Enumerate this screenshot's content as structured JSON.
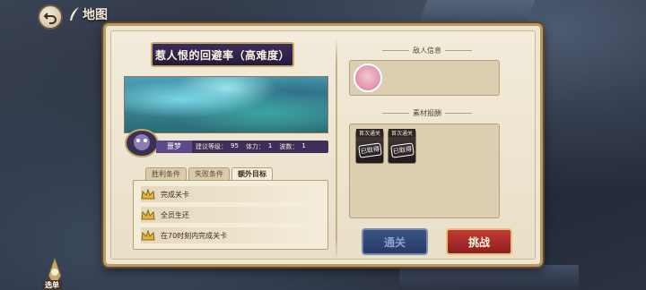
{
  "header": {
    "back_icon": "back-arrow-icon",
    "crumb_icon": "quill-icon",
    "crumb_label": "地图"
  },
  "stage": {
    "title": "惹人恨的回避率（高难度）"
  },
  "stats": {
    "name": "噩梦",
    "level_label": "建议等级：",
    "level_value": "95",
    "stamina_label": "体力：",
    "stamina_value": "1",
    "waves_label": "波数：",
    "waves_value": "1"
  },
  "tabs": [
    {
      "label": "胜利条件",
      "active": false
    },
    {
      "label": "失败条件",
      "active": false
    },
    {
      "label": "额外目标",
      "active": true
    }
  ],
  "goals": [
    {
      "text": "完成关卡",
      "icon": "crown-icon"
    },
    {
      "text": "全员生还",
      "icon": "crown-icon"
    },
    {
      "text": "在70时刻内完成关卡",
      "icon": "crown-icon"
    }
  ],
  "enemy": {
    "label": "敌人信息"
  },
  "rewards": {
    "label": "素材报酬",
    "items": [
      {
        "tag": "首次通关",
        "stamp": "已取得"
      },
      {
        "tag": "首次通关",
        "stamp": "已取得"
      }
    ]
  },
  "buttons": {
    "clear": "通关",
    "challenge": "挑战"
  },
  "menu": {
    "label": "选单",
    "icon": "menu-spire-icon"
  },
  "colors": {
    "title_plate": "#2b1f44",
    "challenge": "#b32f2c",
    "clear": "#33497a",
    "panel": "#efe6d2"
  }
}
